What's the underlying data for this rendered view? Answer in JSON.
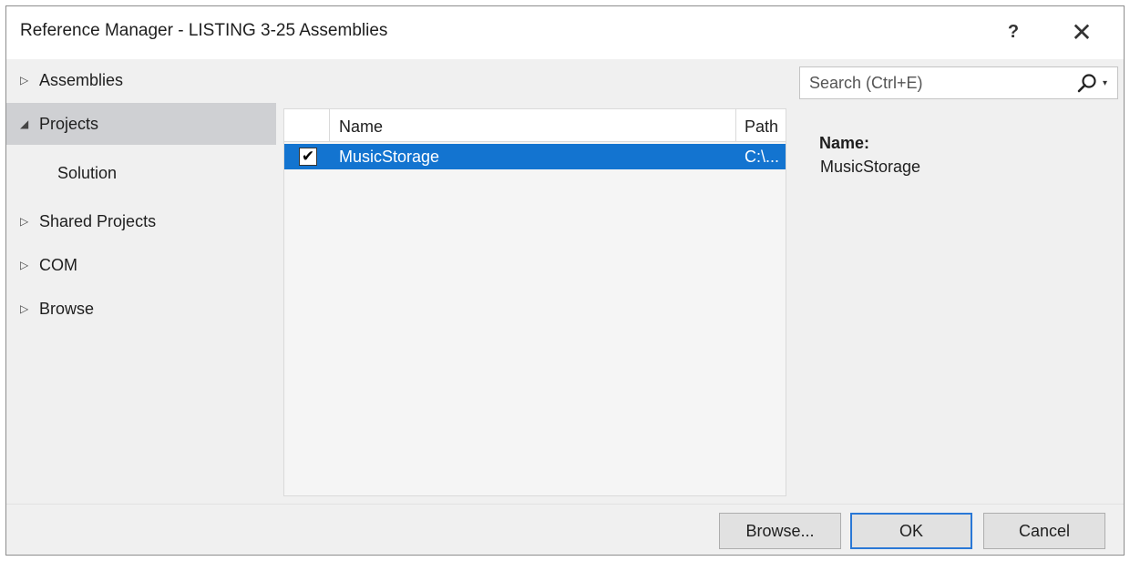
{
  "window": {
    "title": "Reference Manager - LISTING 3-25 Assemblies",
    "help_glyph": "?",
    "close_glyph": "✕"
  },
  "nav": {
    "items": [
      {
        "label": "Assemblies",
        "arrow": "▷",
        "selected": false
      },
      {
        "label": "Projects",
        "arrow": "◢",
        "selected": true
      },
      {
        "label": "Solution",
        "arrow": "",
        "selected": false
      },
      {
        "label": "Shared Projects",
        "arrow": "▷",
        "selected": false
      },
      {
        "label": "COM",
        "arrow": "▷",
        "selected": false
      },
      {
        "label": "Browse",
        "arrow": "▷",
        "selected": false
      }
    ]
  },
  "list": {
    "columns": {
      "name": "Name",
      "path": "Path"
    },
    "rows": [
      {
        "checked": true,
        "check_glyph": "✔",
        "name": "MusicStorage",
        "path": "C:\\..."
      }
    ]
  },
  "search": {
    "placeholder": "Search (Ctrl+E)",
    "icon": "search-icon",
    "dropdown_glyph": "▾"
  },
  "details": {
    "label": "Name:",
    "value": "MusicStorage"
  },
  "footer": {
    "browse_label": "Browse...",
    "ok_label": "OK",
    "cancel_label": "Cancel"
  },
  "colors": {
    "selection": "#1374d0",
    "nav_selected": "#cfd0d3",
    "default_button_border": "#2a78d6"
  }
}
